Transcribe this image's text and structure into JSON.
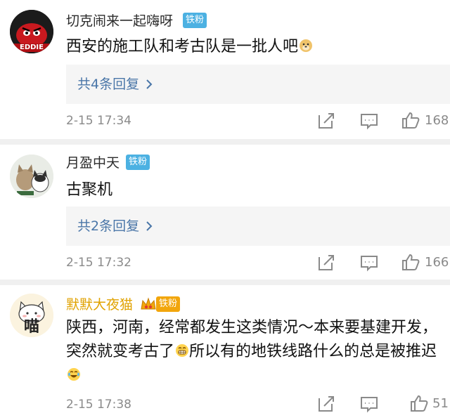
{
  "comments": [
    {
      "username": "切克闹来一起嗨呀",
      "badge": "铁粉",
      "avatar_text": "EDDIE",
      "text": "西安的施工队和考古队是一批人吧",
      "replies_label": "共4条回复",
      "time": "2-15 17:34",
      "likes": "168"
    },
    {
      "username": "月盈中天",
      "badge": "铁粉",
      "text": "古聚机",
      "replies_label": "共2条回复",
      "time": "2-15 17:32",
      "likes": "166"
    },
    {
      "username": "默默大夜猫",
      "badge": "铁粉",
      "avatar_text": "喵",
      "text_part1": "陕西，河南，经常都发生这类情况～本来要基建开发，突然就变考古了",
      "text_part2": "所以有的地铁线路什么的总是被推迟",
      "time": "2-15 17:38",
      "likes": "51"
    }
  ],
  "colors": {
    "badge": "#4cb1e2",
    "link": "#4a76a8",
    "meta": "#8a8a8a",
    "username_3": "#e0a200"
  }
}
